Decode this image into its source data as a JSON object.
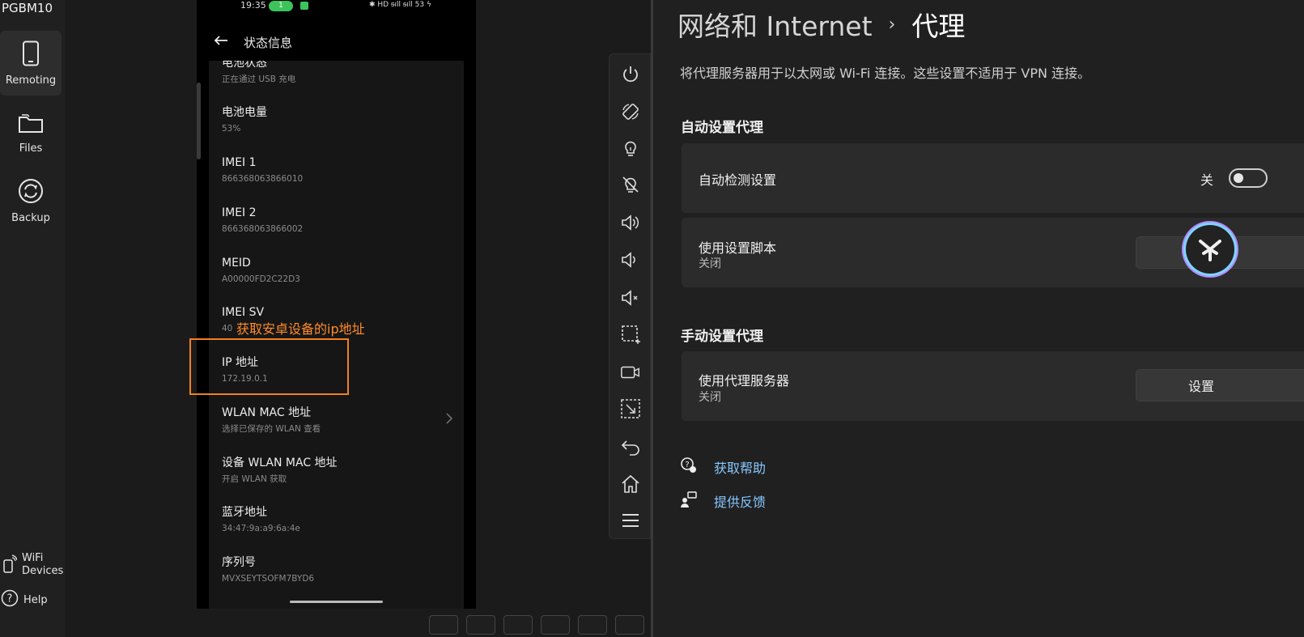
{
  "sidebar": {
    "device_name": "PGBM10",
    "items": [
      {
        "label": "Remoting",
        "icon": "phone-icon",
        "active": true
      },
      {
        "label": "Files",
        "icon": "folder-icon"
      },
      {
        "label": "Backup",
        "icon": "sync-icon"
      }
    ],
    "bottom": [
      {
        "label_line1": "WiFi",
        "label_line2": "Devices",
        "icon": "wifi-device-icon"
      },
      {
        "label": "Help",
        "icon": "help-icon"
      }
    ]
  },
  "phone": {
    "status": {
      "time": "19:35",
      "call_badge": "1",
      "right": "✱ HD ᵴıll ᵴıll 53 ϟ"
    },
    "header": {
      "back_icon": "arrow-left-icon",
      "title": "状态信息"
    },
    "items": [
      {
        "label": "电池状态",
        "value": "正在通过 USB 充电"
      },
      {
        "label": "电池电量",
        "value": "53%"
      },
      {
        "label": "IMEI 1",
        "value": "866368063866010"
      },
      {
        "label": "IMEI 2",
        "value": "866368063866002"
      },
      {
        "label": "MEID",
        "value": "A00000FD2C22D3"
      },
      {
        "label": "IMEI SV",
        "value": "40"
      },
      {
        "label": "IP 地址",
        "value": "172.19.0.1"
      },
      {
        "label": "WLAN MAC 地址",
        "value": "选择已保存的 WLAN 查看"
      },
      {
        "label": "设备 WLAN MAC 地址",
        "value": "开启 WLAN 获取"
      },
      {
        "label": "蓝牙地址",
        "value": "34:47:9a:a9:6a:4e"
      },
      {
        "label": "序列号",
        "value": "MVXSEYTSOFM7BYD6"
      }
    ]
  },
  "annotation": {
    "text": "获取安卓设备的ip地址",
    "color": "#f2801f"
  },
  "toolbar": {
    "tools": [
      "power-icon",
      "rotate-icon",
      "light-on-icon",
      "light-off-icon",
      "volume-up-icon",
      "volume-down-icon",
      "mute-icon",
      "screenshot-region-icon",
      "record-icon",
      "resize-region-icon",
      "back-icon",
      "home-icon",
      "menu-icon"
    ]
  },
  "settings": {
    "breadcrumb": {
      "parent": "网络和 Internet",
      "separator": "›",
      "current": "代理"
    },
    "description": "将代理服务器用于以太网或 Wi-Fi 连接。这些设置不适用于 VPN 连接。",
    "auto_section": {
      "title": "自动设置代理",
      "detect": {
        "title": "自动检测设置",
        "toggle_state": "关"
      },
      "script": {
        "title": "使用设置脚本",
        "subtitle": "关闭",
        "button": "设置"
      }
    },
    "manual_section": {
      "title": "手动设置代理",
      "proxy": {
        "title": "使用代理服务器",
        "subtitle": "关闭",
        "button": "设置"
      }
    },
    "links": [
      {
        "icon": "help-chat-icon",
        "text": "获取帮助"
      },
      {
        "icon": "feedback-icon",
        "text": "提供反馈"
      }
    ],
    "accent_link_color": "#86c8ff"
  }
}
